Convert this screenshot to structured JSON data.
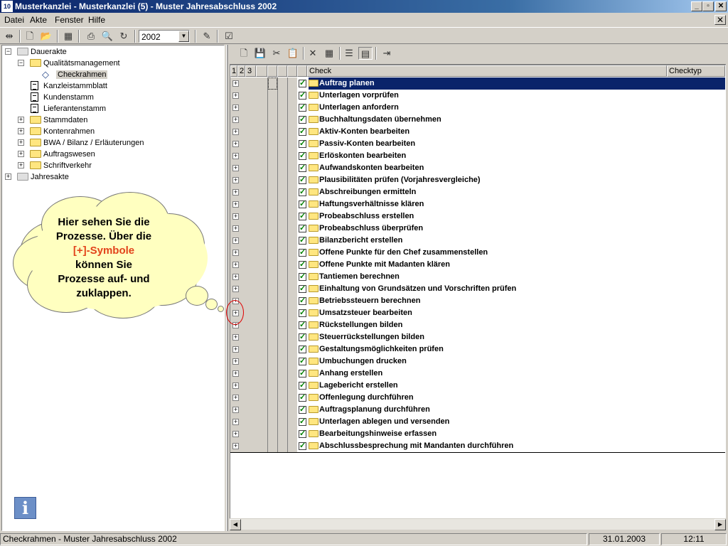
{
  "window": {
    "title": "Musterkanzlei - Musterkanzlei (5) - Muster Jahresabschluss 2002",
    "app_icon_label": "10",
    "minimize": "_",
    "maximize": "▫",
    "close": "✕"
  },
  "menu": {
    "items": [
      "Datei",
      "Akte",
      "Fenster",
      "Hilfe"
    ],
    "mdi_close": "✕"
  },
  "toolbar": {
    "year": "2002"
  },
  "tree": {
    "nodes": [
      {
        "label": "Dauerakte",
        "expander": "−"
      },
      {
        "label": "Qualitätsmanagement",
        "expander": "−"
      },
      {
        "label": "Checkrahmen"
      },
      {
        "label": "Kanzleistammblatt"
      },
      {
        "label": "Kundenstamm"
      },
      {
        "label": "Lieferantenstamm"
      },
      {
        "label": "Stammdaten",
        "expander": "+"
      },
      {
        "label": "Kontenrahmen",
        "expander": "+"
      },
      {
        "label": "BWA / Bilanz / Erläuterungen",
        "expander": "+"
      },
      {
        "label": "Auftragswesen",
        "expander": "+"
      },
      {
        "label": "Schriftverkehr",
        "expander": "+"
      },
      {
        "label": "Jahresakte",
        "expander": "+"
      }
    ]
  },
  "grid": {
    "headers": {
      "c1": "1",
      "c2": "2",
      "c3": "3",
      "check": "Check",
      "checktyp": "Checktyp"
    },
    "rows": [
      "Auftrag planen",
      "Unterlagen vorprüfen",
      "Unterlagen anfordern",
      "Buchhaltungsdaten übernehmen",
      "Aktiv-Konten bearbeiten",
      "Passiv-Konten bearbeiten",
      "Erlöskonten bearbeiten",
      "Aufwandskonten bearbeiten",
      "Plausibilitäten prüfen (Vorjahresvergleiche)",
      "Abschreibungen ermitteln",
      "Haftungsverhältnisse klären",
      "Probeabschluss erstellen",
      "Probeabschluss überprüfen",
      "Bilanzbericht erstellen",
      "Offene Punkte für den Chef zusammenstellen",
      "Offene Punkte mit Madanten klären",
      "Tantiemen berechnen",
      "Einhaltung von Grundsätzen und Vorschriften prüfen",
      "Betriebssteuern berechnen",
      "Umsatzsteuer bearbeiten",
      "Rückstellungen bilden",
      "Steuerrückstellungen bilden",
      "Gestaltungsmöglichkeiten prüfen",
      "Umbuchungen drucken",
      "Anhang erstellen",
      "Lagebericht erstellen",
      "Offenlegung durchführen",
      "Auftragsplanung durchführen",
      "Unterlagen ablegen und versenden",
      "Bearbeitungshinweise erfassen",
      "Abschlussbesprechung mit Mandanten durchführen"
    ],
    "expand_symbol": "+",
    "check_symbol": "✓",
    "selected_index": 0
  },
  "callout": {
    "line1": "Hier sehen Sie die",
    "line2": "Prozesse. Über die",
    "highlight": "[+]-Symbole",
    "line4": "können Sie",
    "line5": "Prozesse auf- und",
    "line6": "zuklappen."
  },
  "info": {
    "glyph": "i"
  },
  "status": {
    "text": "Checkrahmen - Muster Jahresabschluss 2002",
    "date": "31.01.2003",
    "time": "12:11"
  },
  "colors": {
    "title_bar": "#0a246a",
    "selection": "#0a246a",
    "callout_fill": "#ffffc0",
    "callout_highlight": "#e2431b",
    "check_green": "#008000"
  }
}
